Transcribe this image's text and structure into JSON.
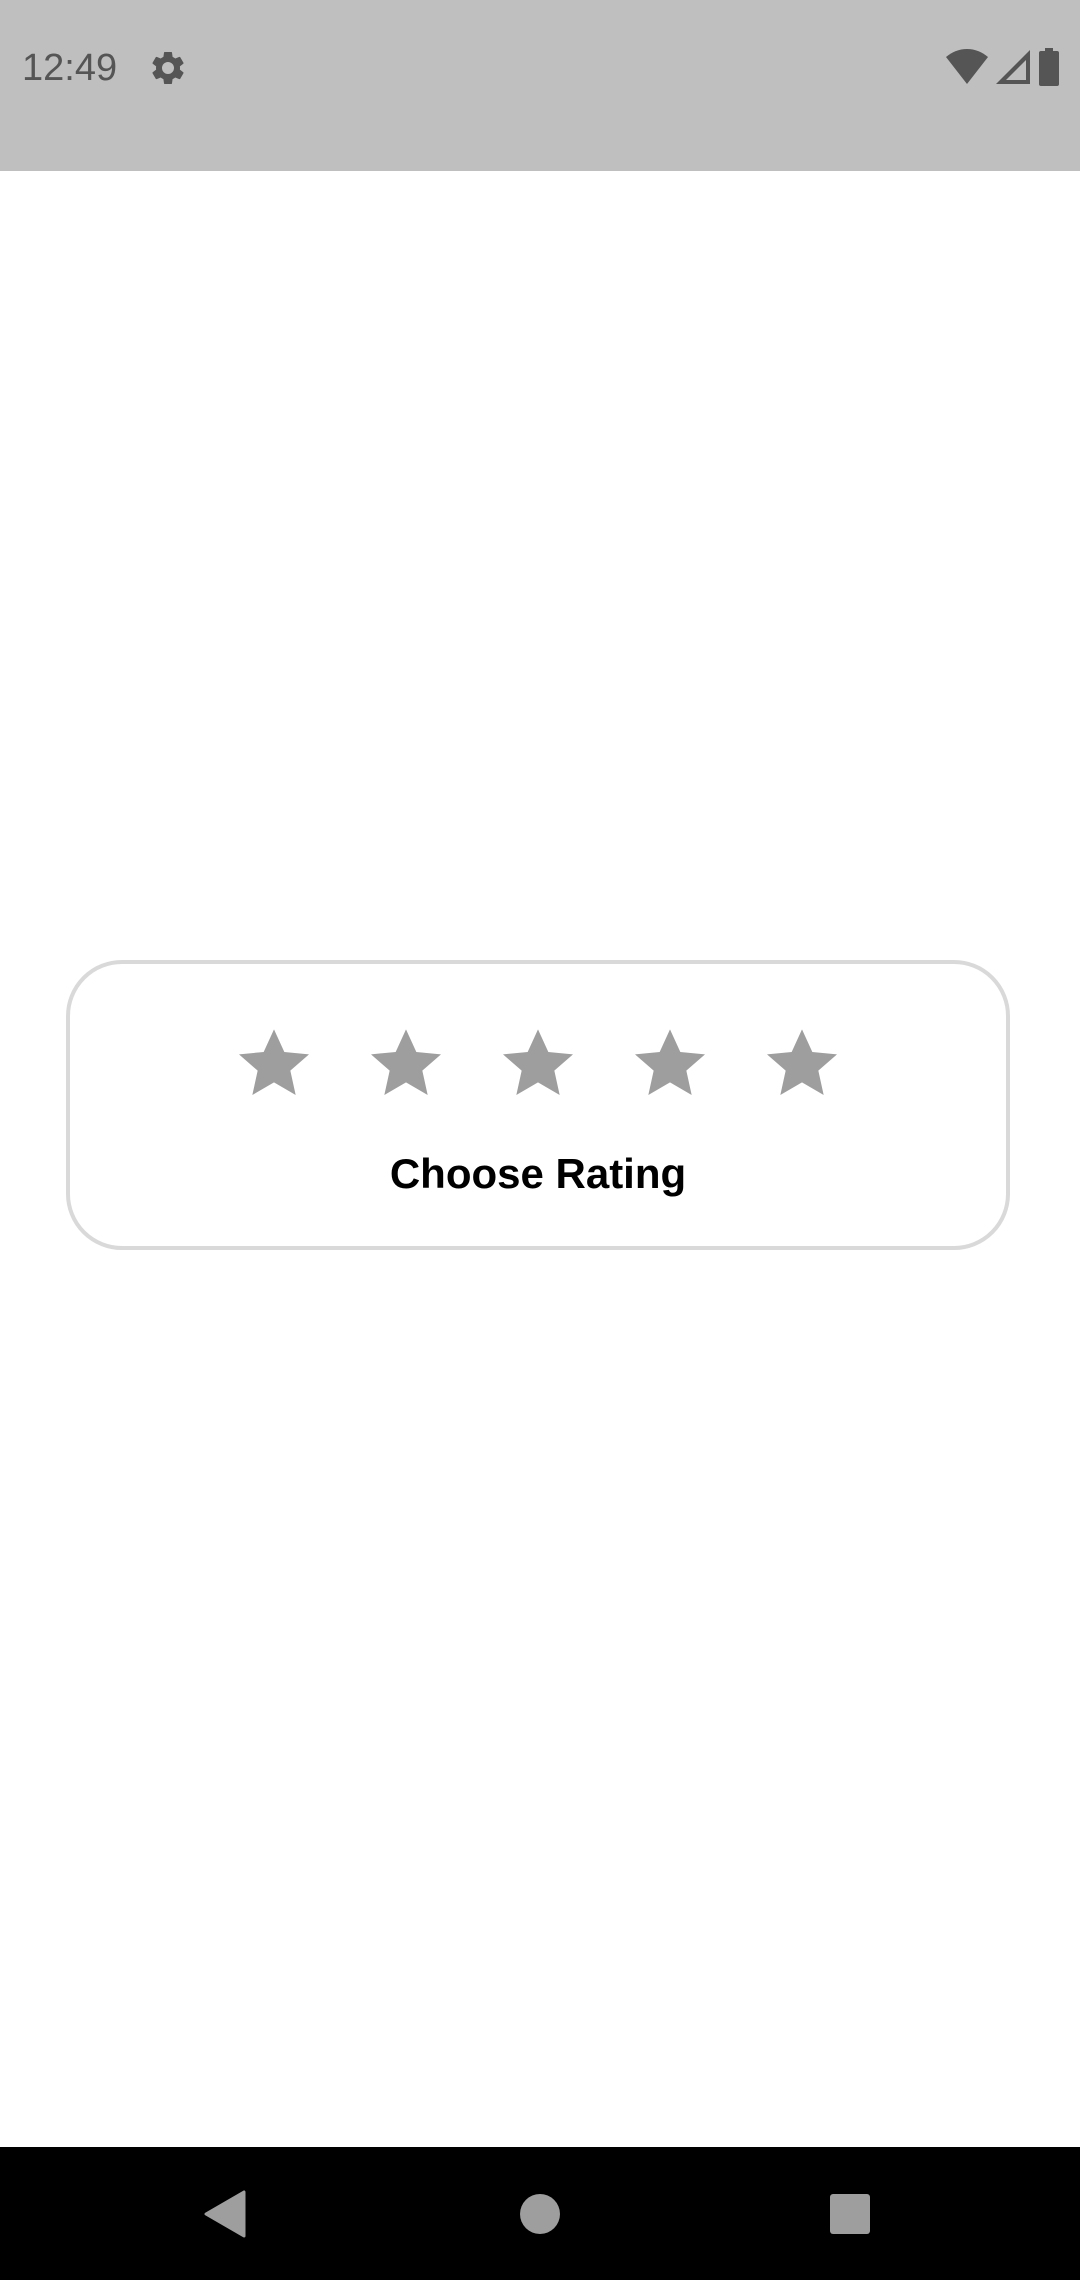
{
  "status_bar": {
    "time": "12:49",
    "icons": [
      "settings-icon",
      "wifi-icon",
      "cellular-signal-icon",
      "battery-icon"
    ],
    "background": "#bfbfbf"
  },
  "rating": {
    "label": "Choose Rating",
    "max_stars": 5,
    "selected_stars": 0,
    "star_color": "#9e9e9e"
  },
  "nav_bar": {
    "buttons": [
      "back-icon",
      "home-icon",
      "recents-icon"
    ]
  }
}
